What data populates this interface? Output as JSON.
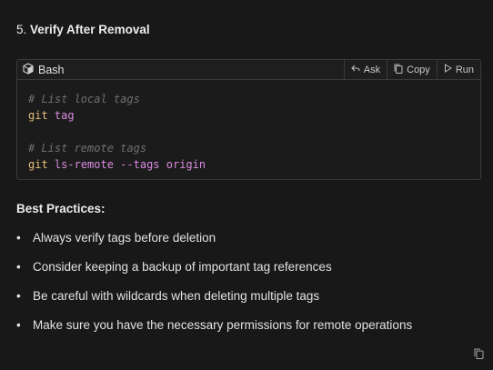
{
  "section": {
    "number": "5.",
    "title": "Verify After Removal"
  },
  "code_block": {
    "language": "Bash",
    "language_icon": "cube-icon",
    "actions": {
      "ask": "Ask",
      "copy": "Copy",
      "run": "Run"
    },
    "lines": [
      {
        "comment": "# List local tags"
      },
      {
        "cmd": "git",
        "args": "tag"
      },
      {},
      {
        "comment": "# List remote tags"
      },
      {
        "cmd": "git",
        "args": "ls-remote --tags origin"
      }
    ]
  },
  "best_practices": {
    "title": "Best Practices:",
    "items": [
      "Always verify tags before deletion",
      "Consider keeping a backup of important tag references",
      "Be careful with wildcards when deleting multiple tags",
      "Make sure you have the necessary permissions for remote operations"
    ]
  },
  "colors": {
    "background": "#181818",
    "comment": "#6f6f6f",
    "command": "#e5c07b",
    "argument": "#d98be0"
  }
}
